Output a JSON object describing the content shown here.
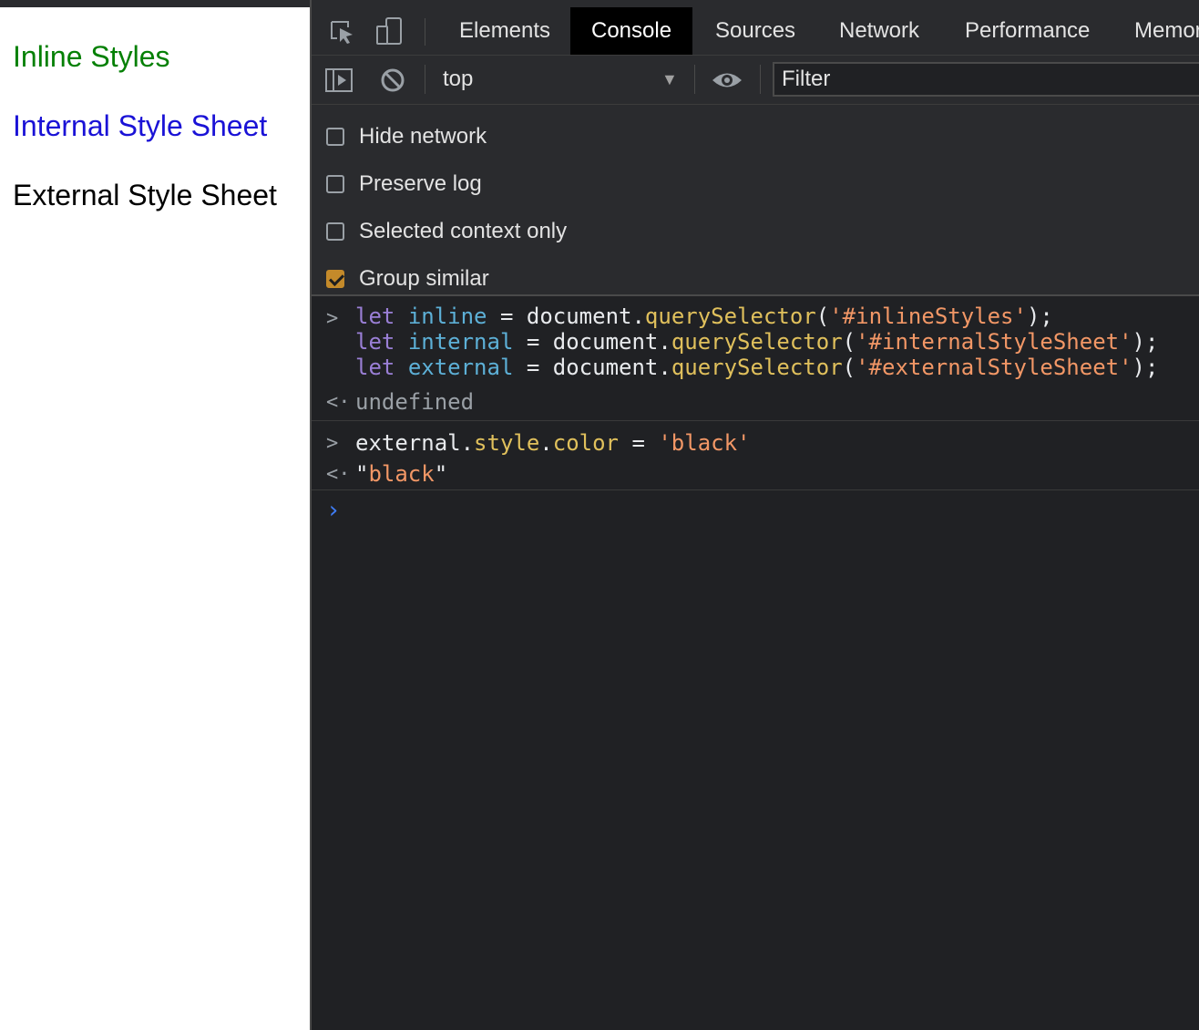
{
  "page": {
    "lines": [
      {
        "text": "Inline Styles",
        "color": "#058005"
      },
      {
        "text": "Internal Style Sheet",
        "color": "#1a12d6"
      },
      {
        "text": "External Style Sheet",
        "color": "#000000"
      }
    ]
  },
  "devtools": {
    "tabs": [
      {
        "label": "Elements",
        "active": false
      },
      {
        "label": "Console",
        "active": true
      },
      {
        "label": "Sources",
        "active": false
      },
      {
        "label": "Network",
        "active": false
      },
      {
        "label": "Performance",
        "active": false
      },
      {
        "label": "Memor",
        "active": false
      }
    ],
    "toolbar": {
      "context": "top",
      "filter_placeholder": "Filter"
    },
    "settings": [
      {
        "label": "Hide network",
        "checked": false
      },
      {
        "label": "Preserve log",
        "checked": false
      },
      {
        "label": "Selected context only",
        "checked": false
      },
      {
        "label": "Group similar",
        "checked": true
      }
    ],
    "console": {
      "input1": {
        "line1": {
          "kw": "let",
          "var": "inline",
          "eq": " = ",
          "obj": "document.",
          "fn": "querySelector",
          "open": "(",
          "str": "'#inlineStyles'",
          "close": ");"
        },
        "line2": {
          "kw": "let",
          "var": "internal",
          "eq": " = ",
          "obj": "document.",
          "fn": "querySelector",
          "open": "(",
          "str": "'#internalStyleSheet'",
          "close": ");"
        },
        "line3": {
          "kw": "let",
          "var": "external",
          "eq": " = ",
          "obj": "document.",
          "fn": "querySelector",
          "open": "(",
          "str": "'#externalStyleSheet'",
          "close": ");"
        }
      },
      "output1": "undefined",
      "input2": {
        "obj": "external.",
        "fn1": "style",
        "dot": ".",
        "fn2": "color",
        "eq": " = ",
        "str": "'black'"
      },
      "output2": {
        "q1": "\"",
        "str": "black",
        "q2": "\""
      }
    }
  },
  "colors": {
    "devtools_bg": "#202124",
    "toolbar_bg": "#2a2b2e",
    "keyword": "#9a7fd6",
    "variable": "#5db0d7",
    "function": "#e0c05c",
    "string": "#f29766",
    "checkbox_checked": "#c48a2a",
    "prompt": "#3f7df6"
  }
}
